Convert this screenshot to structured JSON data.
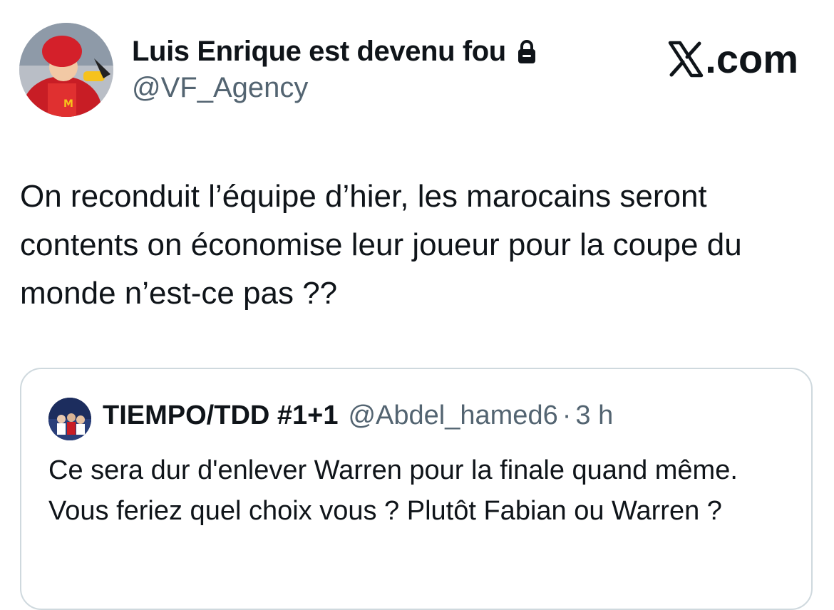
{
  "author": {
    "display_name": "Luis Enrique est devenu fou",
    "handle": "@VF_Agency",
    "avatar_icon": "profile-avatar",
    "lock_icon": "lock-icon"
  },
  "source_label": {
    "logo_icon": "x-logo-icon",
    "suffix": ".com"
  },
  "tweet": {
    "text": "On reconduit l’équipe d’hier, les marocains seront contents on économise leur joueur pour la coupe du monde n’est-ce pas ??"
  },
  "quoted_tweet": {
    "display_name": "TIEMPO/TDD #1+1",
    "handle": "@Abdel_hamed6",
    "separator": "·",
    "time": "3 h",
    "text": "Ce sera dur d'enlever Warren pour la finale quand même. Vous feriez quel choix vous ? Plutôt Fabian ou Warren ?"
  },
  "colors": {
    "primary_text": "#0f1419",
    "secondary_text": "#536471",
    "card_border": "#cfd9de",
    "background": "#ffffff"
  }
}
